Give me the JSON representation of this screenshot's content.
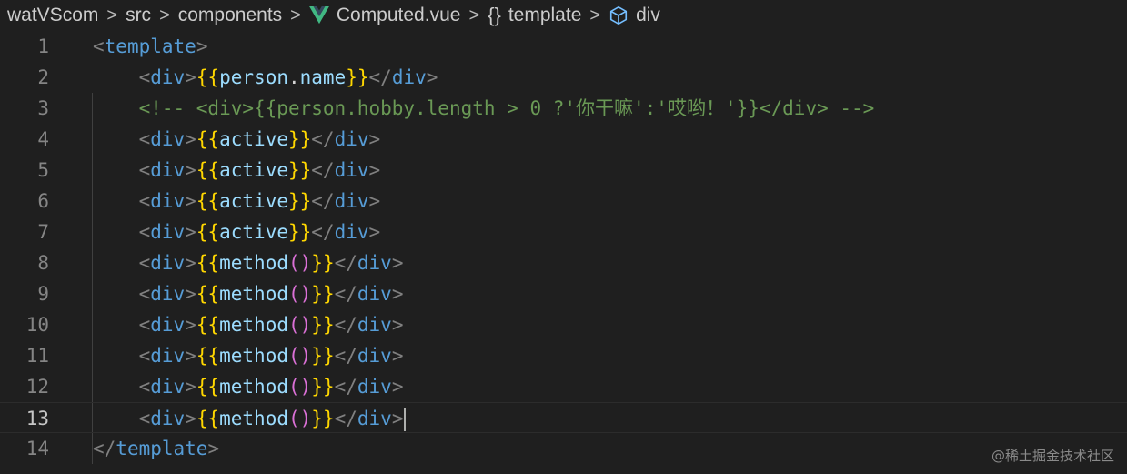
{
  "breadcrumb": {
    "items": [
      {
        "label": "watVScom",
        "icon": "none"
      },
      {
        "label": "src",
        "icon": "none"
      },
      {
        "label": "components",
        "icon": "none"
      },
      {
        "label": "Computed.vue",
        "icon": "vue-icon"
      },
      {
        "label": "template",
        "icon": "braces-icon"
      },
      {
        "label": "div",
        "icon": "cube-icon"
      }
    ],
    "separator": ">"
  },
  "editor": {
    "current_line": 13,
    "lines": [
      {
        "number": "1",
        "text": "<template>"
      },
      {
        "number": "2",
        "text": "    <div>{{person.name}}</div>"
      },
      {
        "number": "3",
        "text": "    <!-- <div>{{person.hobby.length > 0 ?'你干嘛':'哎哟！'}}</div> -->"
      },
      {
        "number": "4",
        "text": "    <div>{{active}}</div>"
      },
      {
        "number": "5",
        "text": "    <div>{{active}}</div>"
      },
      {
        "number": "6",
        "text": "    <div>{{active}}</div>"
      },
      {
        "number": "7",
        "text": "    <div>{{active}}</div>"
      },
      {
        "number": "8",
        "text": "    <div>{{method()}}</div>"
      },
      {
        "number": "9",
        "text": "    <div>{{method()}}</div>"
      },
      {
        "number": "10",
        "text": "    <div>{{method()}}</div>"
      },
      {
        "number": "11",
        "text": "    <div>{{method()}}</div>"
      },
      {
        "number": "12",
        "text": "    <div>{{method()}}</div>"
      },
      {
        "number": "13",
        "text": "    <div>{{method()}}</div>"
      },
      {
        "number": "14",
        "text": "</template>"
      }
    ]
  },
  "colors": {
    "background": "#1f1f1f",
    "tag": "#569cd6",
    "bracket": "#808080",
    "mustache": "#ffd700",
    "paren": "#da70d6",
    "identifier": "#9cdcfe",
    "comment": "#6a9955",
    "vue_green": "#41b883"
  },
  "watermark": "@稀土掘金技术社区"
}
